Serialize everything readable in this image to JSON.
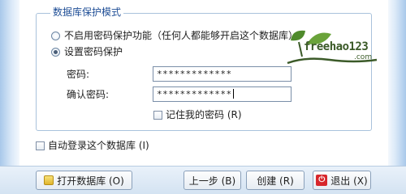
{
  "group": {
    "title": "数据库保护模式"
  },
  "options": {
    "no_password": "不启用密码保护功能（任何人都能够开启这个数据库）",
    "set_password": "设置密码保护"
  },
  "fields": {
    "password_label": "密码:",
    "password_value": "*************",
    "confirm_label": "确认密码:",
    "confirm_value": "*************"
  },
  "remember": {
    "label": "记住我的密码 (R)"
  },
  "auto_login": {
    "label": "自动登录这个数据库 (I)"
  },
  "buttons": {
    "open": "打开数据库 (O)",
    "back": "上一步 (B)",
    "create": "创建 (R)",
    "exit": "退出 (X)"
  },
  "watermark": {
    "brand": "freehao123",
    "domain": ".com"
  },
  "icons": {
    "open": "folder-icon",
    "exit": "power-icon",
    "watermark": "sprout-icon"
  },
  "colors": {
    "group_title": "#1f4e96",
    "exit_icon": "#d7262b"
  }
}
